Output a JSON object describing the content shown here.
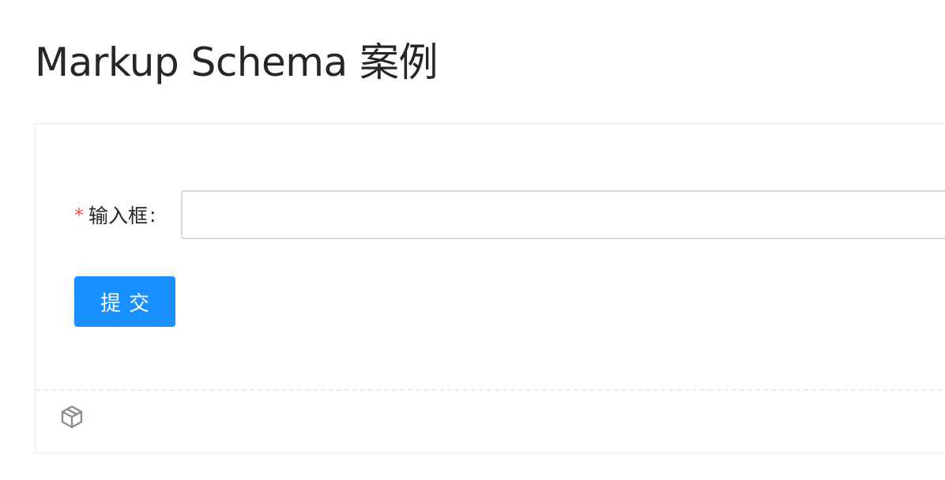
{
  "page": {
    "title": "Markup Schema 案例"
  },
  "form": {
    "field": {
      "required_mark": "*",
      "label": "输入框",
      "colon": ":",
      "value": "",
      "placeholder": ""
    },
    "submit_label": "提交"
  },
  "toolbar": {
    "icon": "codesandbox-icon"
  },
  "colors": {
    "primary": "#1890ff",
    "required": "#ff4d4f",
    "border": "#d9d9d9",
    "card_border": "#ebebeb"
  }
}
